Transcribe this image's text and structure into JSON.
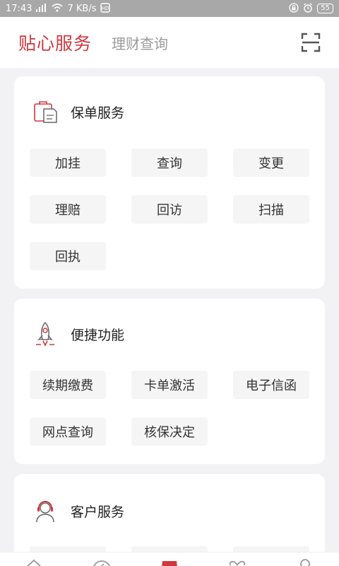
{
  "status_bar": {
    "time": "17:43",
    "network_speed": "7 KB/s",
    "battery": "55"
  },
  "header": {
    "tab_active": "贴心服务",
    "tab_inactive": "理财查询"
  },
  "sections": {
    "policy": {
      "title": "保单服务",
      "buttons": [
        "加挂",
        "查询",
        "变更",
        "理赔",
        "回访",
        "扫描",
        "回执"
      ]
    },
    "quick": {
      "title": "便捷功能",
      "buttons": [
        "续期缴费",
        "卡单激活",
        "电子信函",
        "网点查询",
        "核保决定"
      ]
    },
    "customer": {
      "title": "客户服务"
    }
  },
  "colors": {
    "accent": "#d0383e",
    "background": "#f2f2f4",
    "button_bg": "#f5f5f6"
  }
}
